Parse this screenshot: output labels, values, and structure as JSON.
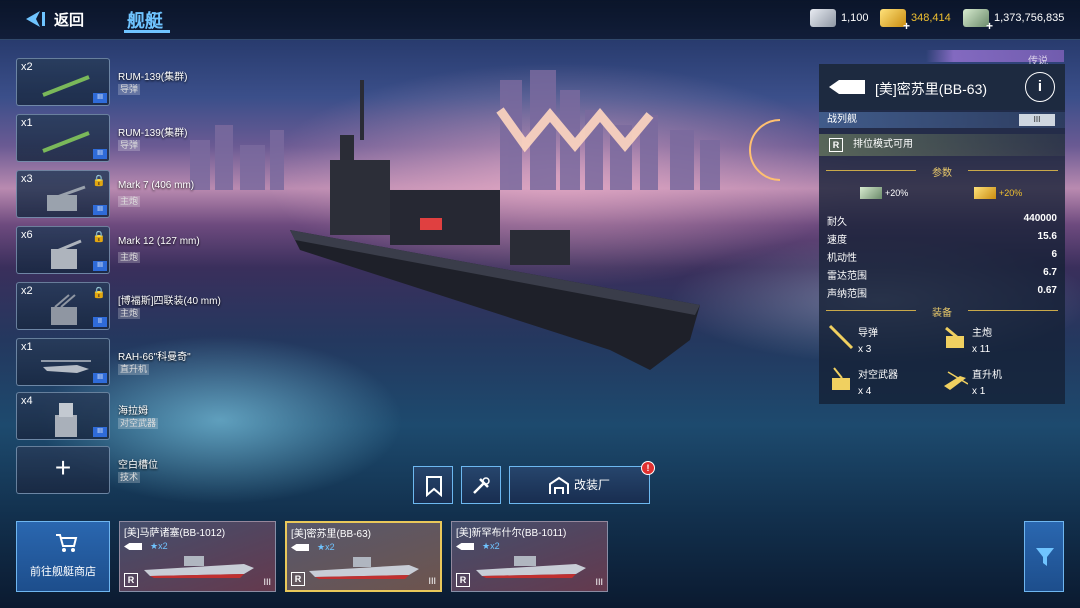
{
  "topbar": {
    "back_label": "返回",
    "title": "舰艇",
    "currencies": [
      {
        "icon": "silver-bar-icon",
        "value": "1,100",
        "color": "#c9ced6"
      },
      {
        "icon": "gold-bar-icon",
        "value": "348,414",
        "color": "#f0c030"
      },
      {
        "icon": "cash-icon",
        "value": "1,373,756,835",
        "color": "#b8d8b0"
      }
    ]
  },
  "equipment": [
    {
      "count": "x2",
      "name": "RUM-139(集群)",
      "type": "导弹",
      "locked": false,
      "icon": "missile-icon"
    },
    {
      "count": "x1",
      "name": "RUM-139(集群)",
      "type": "导弹",
      "locked": false,
      "icon": "missile-icon"
    },
    {
      "count": "x3",
      "name": "Mark 7 (406 mm)",
      "type": "主炮",
      "locked": true,
      "icon": "main-gun-turret-icon"
    },
    {
      "count": "x6",
      "name": "Mark 12 (127 mm)",
      "type": "主炮",
      "locked": true,
      "icon": "gun-turret-icon"
    },
    {
      "count": "x2",
      "name": "[博福斯]四联装(40 mm)",
      "type": "主炮",
      "locked": true,
      "icon": "aa-gun-icon"
    },
    {
      "count": "x1",
      "name": "RAH-66\"科曼奇\"",
      "type": "直升机",
      "locked": false,
      "icon": "helicopter-icon"
    },
    {
      "count": "x4",
      "name": "海拉姆",
      "type": "对空武器",
      "locked": false,
      "icon": "ciws-icon"
    },
    {
      "count": "",
      "name": "空白槽位",
      "type": "技术",
      "locked": false,
      "icon": "plus-icon"
    }
  ],
  "panel": {
    "rarity": "传说",
    "ship_name": "[美]密苏里(BB-63)",
    "info_label": "i",
    "ship_class": "战列舰",
    "tier": "III",
    "mode_text": "排位模式可用",
    "params_title": "参数",
    "bonus_cash": "+20%",
    "bonus_gold": "+20%",
    "stats": [
      {
        "key": "耐久",
        "value": "440000"
      },
      {
        "key": "速度",
        "value": "15.6"
      },
      {
        "key": "机动性",
        "value": "6"
      },
      {
        "key": "雷达范围",
        "value": "6.7"
      },
      {
        "key": "声纳范围",
        "value": "0.67"
      }
    ],
    "equip_title": "装备",
    "weapons": [
      {
        "name": "导弹",
        "count": "x 3",
        "icon": "missile-icon"
      },
      {
        "name": "主炮",
        "count": "x 11",
        "icon": "main-gun-icon"
      },
      {
        "name": "对空武器",
        "count": "x 4",
        "icon": "aa-weapon-icon"
      },
      {
        "name": "直升机",
        "count": "x 1",
        "icon": "helicopter-icon"
      }
    ]
  },
  "center_buttons": {
    "modify_label": "改装厂",
    "modify_badge": "!"
  },
  "bottom": {
    "shop_label": "前往舰艇商店",
    "ships": [
      {
        "name": "[美]马萨诸塞(BB-1012)",
        "stars": "★x2",
        "tier": "III",
        "selected": false
      },
      {
        "name": "[美]密苏里(BB-63)",
        "stars": "★x2",
        "tier": "III",
        "selected": true
      },
      {
        "name": "[美]新罕布什尔(BB-1011)",
        "stars": "★x2",
        "tier": "III",
        "selected": false
      }
    ]
  }
}
